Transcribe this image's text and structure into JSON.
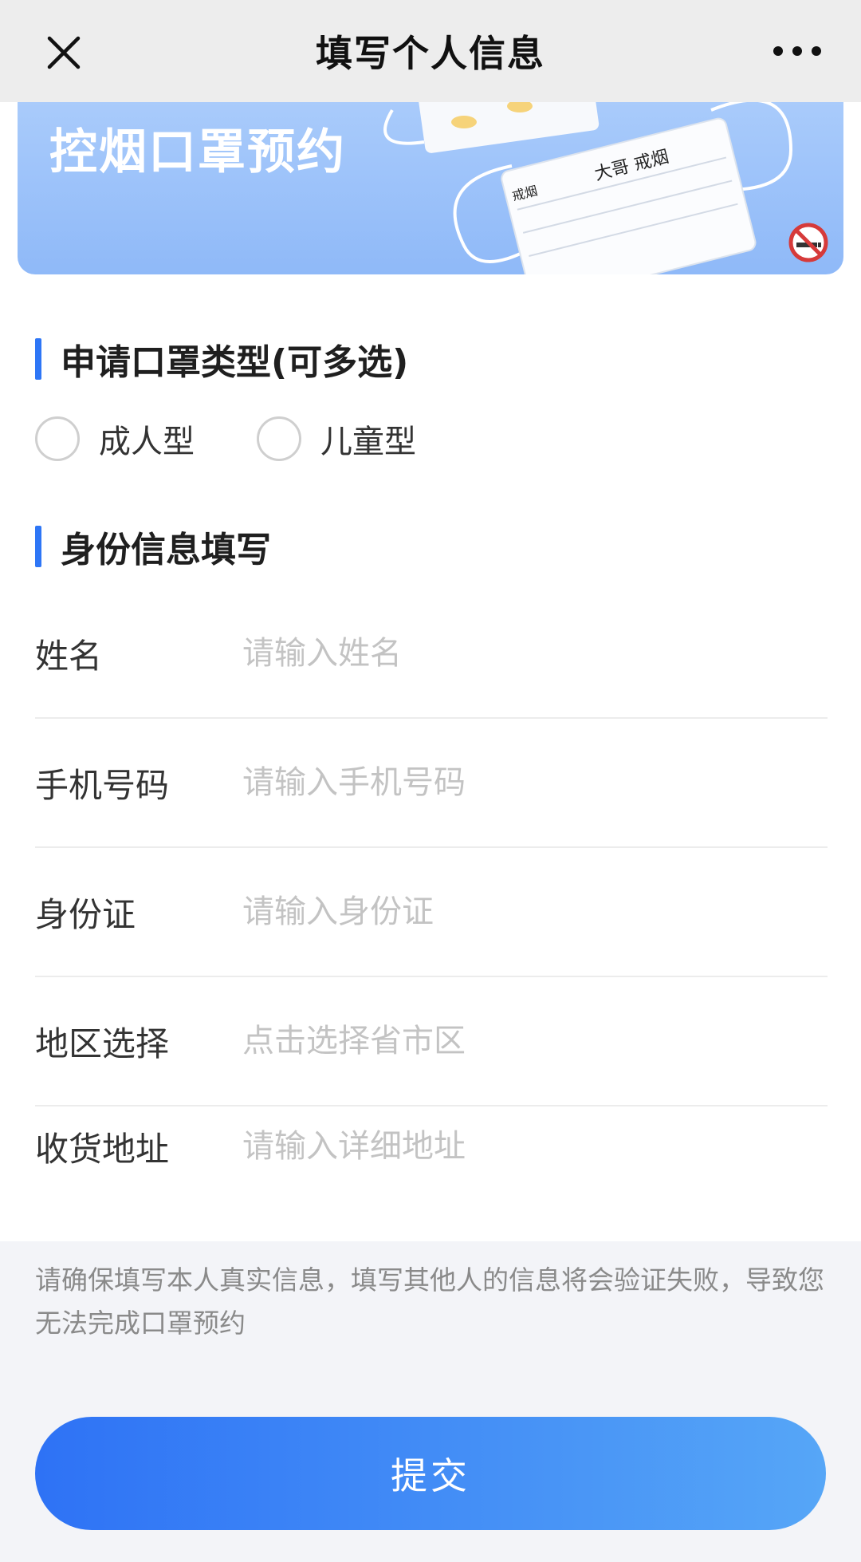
{
  "header": {
    "title": "填写个人信息",
    "close_icon": "close-icon",
    "more_icon": "more-icon"
  },
  "banner": {
    "title": "控烟口罩预约",
    "mask_text_1": "大哥 戒烟",
    "mask_text_2": "戒烟"
  },
  "mask_type": {
    "title": "申请口罩类型(可多选)",
    "options": [
      {
        "label": "成人型",
        "checked": false
      },
      {
        "label": "儿童型",
        "checked": false
      }
    ]
  },
  "identity": {
    "title": "身份信息填写",
    "fields": [
      {
        "label": "姓名",
        "placeholder": "请输入姓名",
        "value": ""
      },
      {
        "label": "手机号码",
        "placeholder": "请输入手机号码",
        "value": ""
      },
      {
        "label": "身份证",
        "placeholder": "请输入身份证",
        "value": ""
      },
      {
        "label": "地区选择",
        "placeholder": "点击选择省市区",
        "value": ""
      },
      {
        "label": "收货地址",
        "placeholder": "请输入详细地址",
        "value": ""
      }
    ]
  },
  "notice": "请确保填写本人真实信息，填写其他人的信息将会验证失败，导致您无法完成口罩预约",
  "submit_label": "提交",
  "colors": {
    "accent": "#2e76f6",
    "button_start": "#2e72f5",
    "button_end": "#56a6f7",
    "banner": "#9ec3fa"
  }
}
